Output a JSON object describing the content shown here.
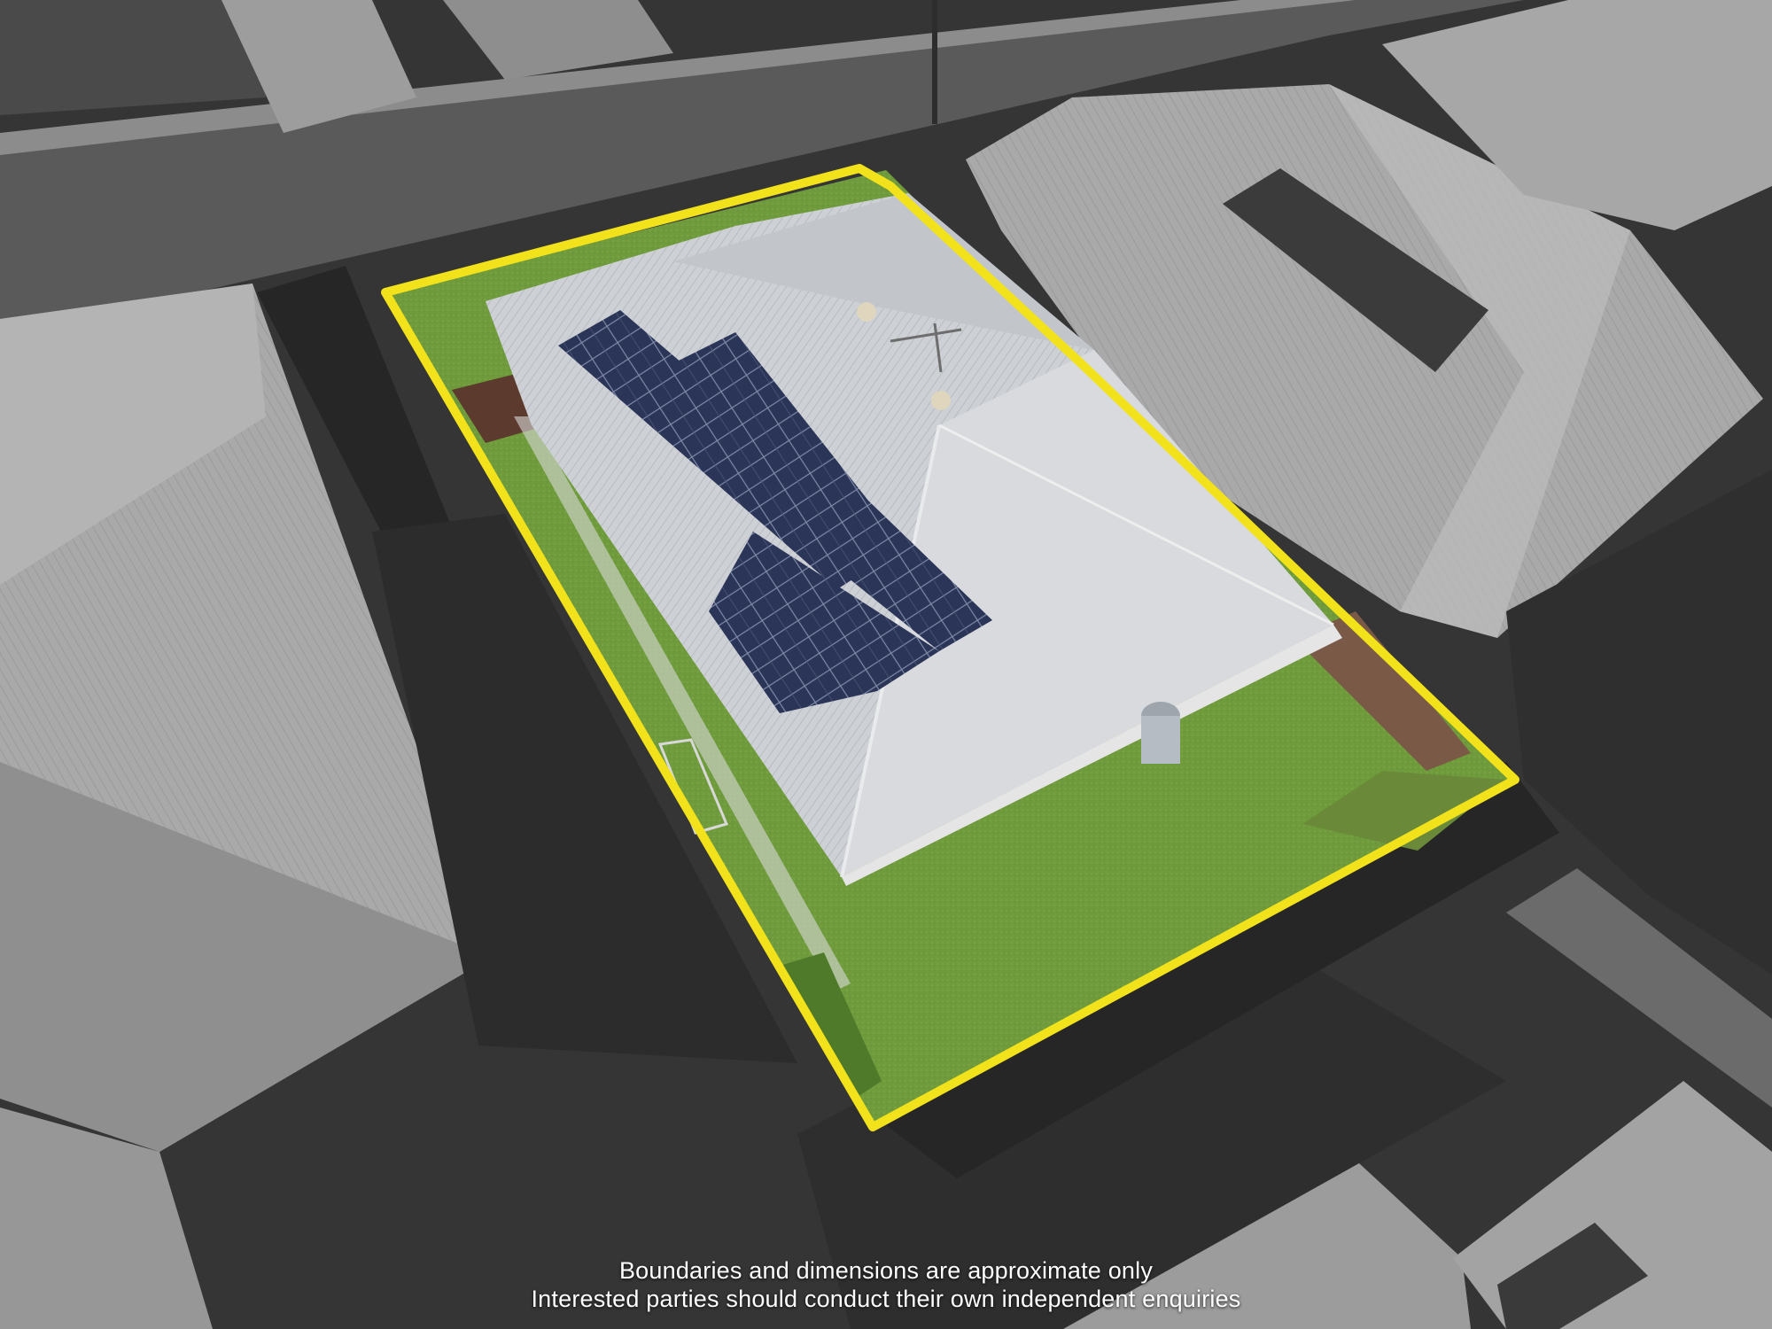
{
  "disclaimer": {
    "line1": "Boundaries and dimensions are approximate only",
    "line2": "Interested parties should conduct their own independent enquiries"
  },
  "colors": {
    "boundary": "#f2e21b",
    "lawn": "#6f9a3c",
    "roof": "#c9ccd0",
    "solar_panel": "#2a3352",
    "surroundings": "#6e6e6e"
  }
}
